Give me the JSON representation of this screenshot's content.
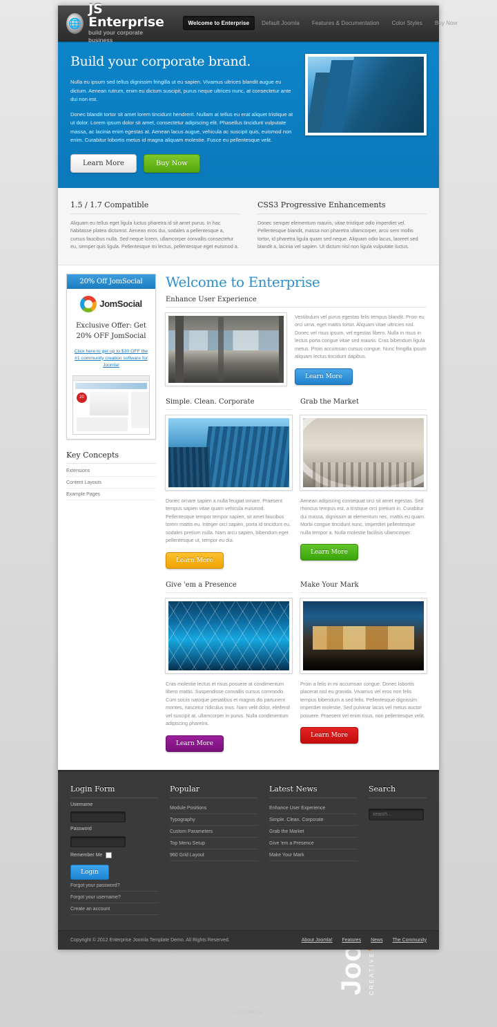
{
  "header": {
    "brand_title": "JS Enterprise",
    "brand_tagline": "build your corporate business",
    "logo_icon": "globe-icon",
    "nav": [
      {
        "label": "Welcome to Enterprise",
        "active": true
      },
      {
        "label": "Default Joomla",
        "active": false
      },
      {
        "label": "Features & Documentation",
        "active": false
      },
      {
        "label": "Color Styles",
        "active": false
      },
      {
        "label": "Buy Now",
        "active": false
      }
    ]
  },
  "hero": {
    "heading": "Build your corporate brand.",
    "paragraph1": "Nulla eu ipsum sed tellus dignissim fringilla ut eu sapien. Vivamus ultrices blandit augue eu dictum. Aenean rutrum, enim eu dictum suscipit, purus neque ultrices nunc, at consectetur ante dui non est.",
    "paragraph2": "Donec blandit tortor sit amet lorem tincidunt hendrerit. Nullam at tellus eu erat aliquet tristique at ut dolor. Lorem ipsum dolor sit amet, consectetur adipiscing elit. Phasellus tincidunt vulputate massa, ac lacinia enim egestas at. Aenean lacus augue, vehicula ac suscipit quis, euismod non enim. Curabitur lobortis metus id magna aliquam molestie. Fusce eu pellentesque velit.",
    "btn_learn": "Learn More",
    "btn_buy": "Buy Now",
    "image_alt": "skyscrapers-photo"
  },
  "features": [
    {
      "title": "1.5 / 1.7 Compatible",
      "body": "Aliquam eu tellus eget ligula luctus pharetra id sit amet purus. In hac habitasse platea dictumst. Aenean eros dui, sodales a pellentesque a, cursus faucibus nulla. Sed neque lorem, ullamcorper convallis consectetur eu, semper quis ligula. Pellentesque mi lectus, pellentesque eget euismod a."
    },
    {
      "title": "CSS3 Progressive Enhancements",
      "body": "Donec semper elementum mauris, vitae tristique odio imperdiet vel. Pellentesque blandit, massa non pharetra ullamcorper, arcu sem mollis tortor, id pharetra ligula quam sed neque. Aliquam odio lacus, laoreet sed blandit a, lacinia vel sapien. Ut dictum nisl non ligula vulputate luctus."
    }
  ],
  "sidebar": {
    "ad": {
      "header": "20% Off JomSocial",
      "logo_text": "JomSocial",
      "logo_icon": "jomsocial-swirl-icon",
      "offer_line1": "Exclusive Offer: Get",
      "offer_line2": "20% OFF JomSocial",
      "link_line1": "Click here to get up to $30 OFF",
      "link_line2": "the #1 community creation",
      "link_line3": "software for Joomla!",
      "screenshot_alt": "jomsocial-screenshot"
    },
    "key_concepts": {
      "title": "Key Concepts",
      "items": [
        "Extensions",
        "Content Layouts",
        "Example Pages"
      ]
    }
  },
  "content": {
    "page_title": "Welcome to Enterprise",
    "top_article": {
      "title": "Enhance User Experience",
      "body": "Vestibulum vel purus egestas felis tempus blandit. Proin eu orci urna, eget mattis tortor. Aliquam vitae ultricies nisl. Donec vel risus ipsum, vel egestas libero. Nulla in risus in lectus porta congue vitae sed mauris. Cras bibendum ligula metus. Proin accumsan cursus congue. Nunc fringilla ipsum aliquam lectus tincidunt dapibus.",
      "button": "Learn More",
      "button_color": "#2081cd",
      "image_alt": "balcony-view-photo"
    },
    "articles": [
      {
        "title": "Simple. Clean. Corporate",
        "body": "Donec ornare sapien a nulla feugiat ornare. Praesent tempus sapien vitae quam vehicula euismod. Pellentesque tempor tempor sapien, sit amet faucibus lorem mattis eu. Integer orci sapien, porta id tincidunt eu, sodales pretium nulla. Nam arcu sapien, bibendum eget pellentesque ut, tempor eu dui.",
        "button": "Learn More",
        "button_color": "#f0a202",
        "image_alt": "modern-glass-building-photo"
      },
      {
        "title": "Grab the Market",
        "body": "Aenean adipiscing consequat orci sit amet egestas. Sed rhoncus tempus est, a tristique orci pretium in. Curabitur dui massa, dignissim at elementum nec, mattis eu quam. Morbi congue tincidunt nunc, imperdiet pellentesque nulla tempor a. Nulla molestie facilisis ullamcorper.",
        "button": "Learn More",
        "button_color": "#3ba30c",
        "image_alt": "atrium-interior-photo"
      },
      {
        "title": "Give 'em a Presence",
        "body": "Cras molestie lectus et risus posuere at condimentum libero mattis. Suspendisse convallis cursus commodo. Cum sociis natoque penatibus et magnis dis parturient montes, nascetur ridiculus mus. Nam velit dolor, eleifend vel suscipit at, ullamcorper in purus. Nulla condimentum adipiscing pharetra.",
        "button": "Learn More",
        "button_color": "#79107a",
        "image_alt": "blue-glass-ceiling-photo"
      },
      {
        "title": "Make Your Mark",
        "body": "Proin a felis in mi accumsan congue. Donec lobortis placerat nisl eu gravida. Vivamus vel eros non felis tempus bibendum a sed felis. Pellentesque dignissim imperdiet molestie. Sed pulvinar lacus vel metus auctor posuere. Praesent vel enim risus, non pellentesque velit.",
        "button": "Learn More",
        "button_color": "#c50d0d",
        "image_alt": "building-at-dusk-photo"
      }
    ]
  },
  "footer": {
    "login": {
      "title": "Login Form",
      "username_label": "Username",
      "username_value": "",
      "password_label": "Password",
      "password_value": "",
      "remember_label": "Remember Me",
      "login_button": "Login",
      "links": [
        "Forgot your password?",
        "Forgot your username?",
        "Create an account"
      ]
    },
    "popular": {
      "title": "Popular",
      "items": [
        "Module Positions",
        "Typography",
        "Custom Parameters",
        "Top Menu Setup",
        "960 Grid Layout"
      ]
    },
    "latest_news": {
      "title": "Latest News",
      "items": [
        "Enhance User Experience",
        "Simple. Clean. Corporate",
        "Grab the Market",
        "Give 'em a Presence",
        "Make Your Mark"
      ]
    },
    "search": {
      "title": "Search",
      "placeholder": "search...",
      "value": ""
    }
  },
  "copyright": {
    "text": "Copyright © 2012 Enterprise Joomla Template Demo. All Rights Reserved.",
    "links": [
      "About Joomla!",
      "Features",
      "News",
      "The Community"
    ]
  },
  "watermark": {
    "text": "JoomlaFox",
    "subtitle": "CREATIVE WEB STUDIO",
    "icon": "fox-icon",
    "accent": "#f39200"
  },
  "page_footer_mark": "JoomlaPack"
}
